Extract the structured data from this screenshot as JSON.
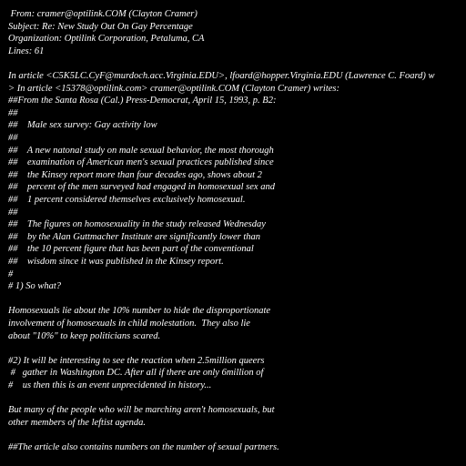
{
  "theme": {
    "background": "#000000",
    "text_color": "#ffffff"
  },
  "message": {
    "lines": [
      " From: cramer@optilink.COM (Clayton Cramer)",
      "Subject: Re: New Study Out On Gay Percentage",
      "Organization: Optilink Corporation, Petaluma, CA",
      "Lines: 61",
      "",
      "In article <C5K5LC.CyF@murdoch.acc.Virginia.EDU>, lfoard@hopper.Virginia.EDU (Lawrence C. Foard) w",
      "> In article <15378@optilink.com> cramer@optilink.COM (Clayton Cramer) writes:",
      "##From the Santa Rosa (Cal.) Press-Democrat, April 15, 1993, p. B2:",
      "##",
      "##    Male sex survey: Gay activity low",
      "##",
      "##    A new natonal study on male sexual behavior, the most thorough",
      "##    examination of American men's sexual practices published since",
      "##    the Kinsey report more than four decades ago, shows about 2",
      "##    percent of the men surveyed had engaged in homosexual sex and",
      "##    1 percent considered themselves exclusively homosexual.",
      "##",
      "##    The figures on homosexuality in the study released Wednesday",
      "##    by the Alan Guttmacher Institute are significantly lower than",
      "##    the 10 percent figure that has been part of the conventional",
      "##    wisdom since it was published in the Kinsey report.",
      "#",
      "# 1) So what?",
      "",
      "Homosexuals lie about the 10% number to hide the disproportionate",
      "involvement of homosexuals in child molestation.  They also lie",
      "about \"10%\" to keep politicians scared.",
      "",
      "#2) It will be interesting to see the reaction when 2.5million queers",
      " #   gather in Washington DC. After all if there are only 6million of",
      "#    us then this is an event unprecidented in history...",
      "",
      "But many of the people who will be marching aren't homosexuals, but",
      "other members of the leftist agenda.",
      "",
      "##The article also contains numbers on the number of sexual partners."
    ]
  }
}
